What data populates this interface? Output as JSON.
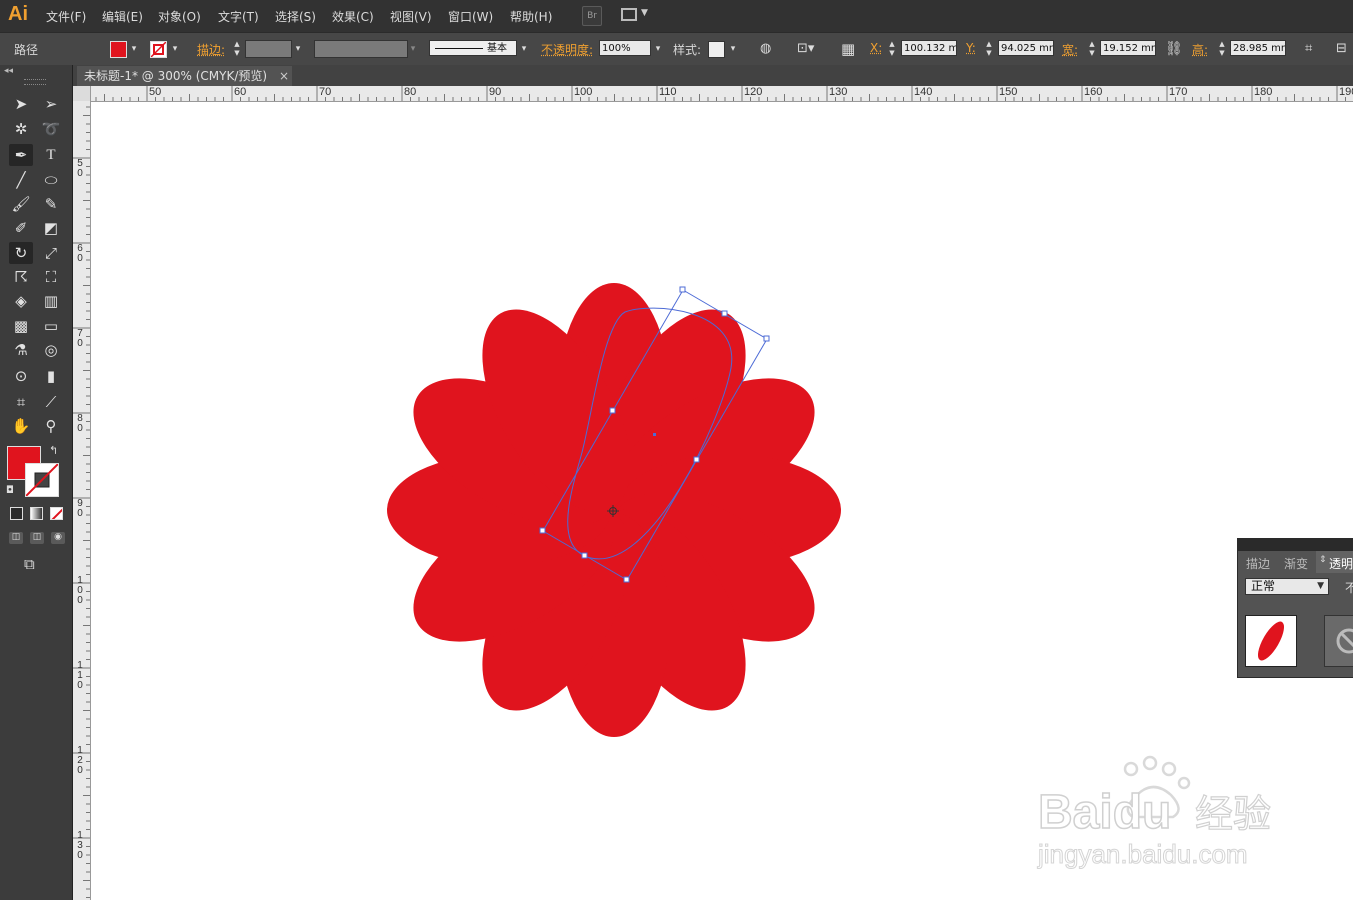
{
  "app": {
    "logo": "Ai"
  },
  "menu": [
    "文件(F)",
    "编辑(E)",
    "对象(O)",
    "文字(T)",
    "选择(S)",
    "效果(C)",
    "视图(V)",
    "窗口(W)",
    "帮助(H)"
  ],
  "menu_extra": {
    "bridge_label": "Br"
  },
  "control_bar": {
    "object_type": "路径",
    "stroke_label": "描边:",
    "stroke_style": "基本",
    "opacity_label": "不透明度:",
    "opacity_value": "100%",
    "style_label": "样式:",
    "x_label": "X:",
    "x_value": "100.132 m",
    "y_label": "Y:",
    "y_value": "94.025 mm",
    "w_label": "宽:",
    "w_value": "19.152 mm",
    "h_label": "高:",
    "h_value": "28.985 mm"
  },
  "document": {
    "tab_title": "未标题-1* @ 300% (CMYK/预览)",
    "close": "×"
  },
  "rulers": {
    "horizontal": [
      "50",
      "60",
      "70",
      "80",
      "90",
      "100",
      "110",
      "120",
      "130",
      "140",
      "150",
      "160",
      "170",
      "180",
      "190"
    ],
    "vertical": [
      "5\n0",
      "6\n0",
      "7\n0",
      "8\n0",
      "9\n0",
      "1\n0\n0",
      "1\n1\n0",
      "1\n2\n0",
      "1\n3\n0"
    ]
  },
  "artwork": {
    "fill_color": "#e0141e",
    "petal_count": 12,
    "selection_color": "#4d6bd6"
  },
  "colors": {
    "fill": "#e0141e",
    "accent": "#f0a030"
  },
  "transparency_panel": {
    "tabs": [
      "描边",
      "渐变",
      "透明"
    ],
    "blend_mode": "正常",
    "opacity_partial": "不"
  },
  "watermark": {
    "brand": "Baidu",
    "brand_cn": "经验",
    "url": "jingyan.baidu.com"
  }
}
